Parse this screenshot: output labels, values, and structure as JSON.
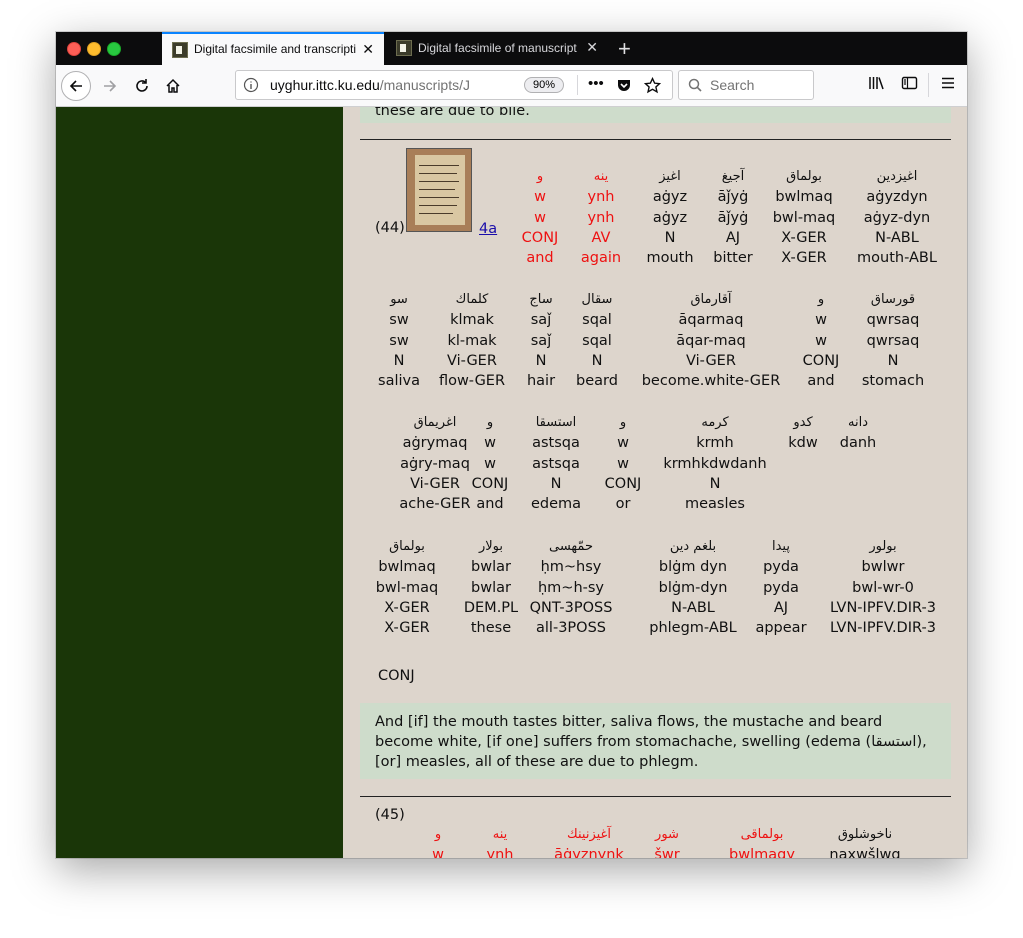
{
  "browser": {
    "tabs": [
      {
        "title": "Digital facsimile and transcription",
        "active": true
      },
      {
        "title": "Digital facsimile of manuscript J",
        "active": false
      }
    ],
    "new_tab": "+",
    "url_host": "uyghur.ittc.ku.edu",
    "url_path": "/manuscripts/J",
    "zoom": "90%",
    "page_actions": "•••",
    "search_placeholder": "Search"
  },
  "page": {
    "prev_translation_fragment": "these are due to bile.",
    "entry44": {
      "number": "(44)",
      "page_link": "4a",
      "lines": [
        [
          {
            "ar": "و",
            "t": "w",
            "s": "w",
            "g": "CONJ",
            "e": "and",
            "red": true
          },
          {
            "ar": "ينه",
            "t": "ynh",
            "s": "ynh",
            "g": "AV",
            "e": "again",
            "red": true
          },
          {
            "ar": "اغيز",
            "t": "aġyz",
            "s": "aġyz",
            "g": "N",
            "e": "mouth"
          },
          {
            "ar": "آجيغ",
            "t": "āǰyġ",
            "s": "āǰyġ",
            "g": "AJ",
            "e": "bitter"
          },
          {
            "ar": "بولماق",
            "t": "bwlmaq",
            "s": "bwl-maq",
            "g": "X-GER",
            "e": "X-GER"
          },
          {
            "ar": "اغيزدين",
            "t": "aġyzdyn",
            "s": "aġyz-dyn",
            "g": "N-ABL",
            "e": "mouth-ABL"
          }
        ],
        [
          {
            "ar": "سو",
            "t": "sw",
            "s": "sw",
            "g": "N",
            "e": "saliva"
          },
          {
            "ar": "كلماك",
            "t": "klmak",
            "s": "kl-mak",
            "g": "Vi-GER",
            "e": "flow-GER"
          },
          {
            "ar": "ساج",
            "t": "saǰ",
            "s": "saǰ",
            "g": "N",
            "e": "hair"
          },
          {
            "ar": "سقال",
            "t": "sqal",
            "s": "sqal",
            "g": "N",
            "e": "beard"
          },
          {
            "ar": "آقارماق",
            "t": "āqarmaq",
            "s": "āqar-maq",
            "g": "Vi-GER",
            "e": "become.white-GER"
          },
          {
            "ar": "و",
            "t": "w",
            "s": "w",
            "g": "CONJ",
            "e": "and"
          },
          {
            "ar": "قورساق",
            "t": "qwrsaq",
            "s": "qwrsaq",
            "g": "N",
            "e": "stomach"
          }
        ],
        [
          {
            "ar": "اغريماق",
            "t": "aġrymaq",
            "s": "aġry-maq",
            "g": "Vi-GER",
            "e": "ache-GER"
          },
          {
            "ar": "و",
            "t": "w",
            "s": "w",
            "g": "CONJ",
            "e": "and"
          },
          {
            "ar": "استسقا",
            "t": "astsqa",
            "s": "astsqa",
            "g": "N",
            "e": "edema"
          },
          {
            "ar": "و",
            "t": "w",
            "s": "w",
            "g": "CONJ",
            "e": "or"
          },
          {
            "ar": "كرمه",
            "t": "krmh",
            "s": "krmhkdwdanh",
            "g": "N",
            "e": "measles"
          },
          {
            "ar": "كدو",
            "t": "kdw",
            "s": "",
            "g": "",
            "e": ""
          },
          {
            "ar": "دانه",
            "t": "danh",
            "s": "",
            "g": "",
            "e": ""
          }
        ],
        [
          {
            "ar": "بولماق",
            "t": "bwlmaq",
            "s": "bwl-maq",
            "g": "X-GER",
            "e": "X-GER"
          },
          {
            "ar": "بولار",
            "t": "bwlar",
            "s": "bwlar",
            "g": "DEM.PL",
            "e": "these"
          },
          {
            "ar": "حمّهسى",
            "t": "ḥm~hsy",
            "s": "ḥm~h-sy",
            "g": "QNT-3POSS",
            "e": "all-3POSS"
          },
          {
            "ar": "بلغم دين",
            "t": "blġm dyn",
            "s": "blġm-dyn",
            "g": "N-ABL",
            "e": "phlegm-ABL"
          },
          {
            "ar": "پيدا",
            "t": "pyda",
            "s": "pyda",
            "g": "AJ",
            "e": "appear"
          },
          {
            "ar": "بولور",
            "t": "bwlwr",
            "s": "bwl-wr-0",
            "g": "LVN-IPFV.DIR-3",
            "e": "LVN-IPFV.DIR-3"
          }
        ]
      ],
      "trailing": "CONJ",
      "translation": "And [if] the mouth tastes bitter, saliva flows, the mustache and beard become white, [if one] suffers from stomachache, swelling (edema (استسقا), [or] measles, all of these are due to phlegm."
    },
    "entry45": {
      "number": "(45)",
      "tokens": [
        {
          "ar": "و",
          "t": "w",
          "red": true
        },
        {
          "ar": "ينه",
          "t": "ynh",
          "red": true
        },
        {
          "ar": "آغيزنينك",
          "t": "āġyznynk",
          "red": true
        },
        {
          "ar": "شور",
          "t": "šwr",
          "red": true
        },
        {
          "ar": "بولماقى",
          "t": "bwlmaqy",
          "red": true
        },
        {
          "ar": "ناخوشلوق",
          "t": "naxwšlwq",
          "red": false
        }
      ]
    }
  }
}
